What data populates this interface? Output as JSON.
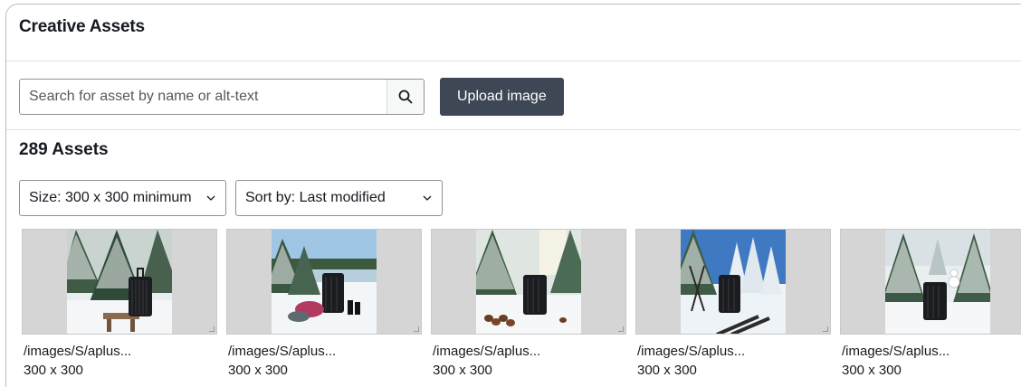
{
  "header": {
    "title": "Creative Assets"
  },
  "search": {
    "placeholder": "Search for asset by name or alt-text",
    "value": ""
  },
  "toolbar": {
    "upload_label": "Upload image"
  },
  "summary": {
    "count_label": "289 Assets"
  },
  "filters": {
    "size": {
      "selected": "Size: 300 x 300 minimum"
    },
    "sort": {
      "selected": "Sort by: Last modified"
    }
  },
  "assets": [
    {
      "name": "/images/S/aplus...",
      "dimensions": "300 x 300"
    },
    {
      "name": "/images/S/aplus...",
      "dimensions": "300 x 300"
    },
    {
      "name": "/images/S/aplus...",
      "dimensions": "300 x 300"
    },
    {
      "name": "/images/S/aplus...",
      "dimensions": "300 x 300"
    },
    {
      "name": "/images/S/aplus...",
      "dimensions": "300 x 300"
    }
  ],
  "colors": {
    "primary_button": "#3d4756",
    "border": "#8d9096",
    "thumb_background": "#d5d5d5"
  },
  "icons": {
    "search": "search-icon",
    "dropdown": "chevron-down-icon"
  }
}
